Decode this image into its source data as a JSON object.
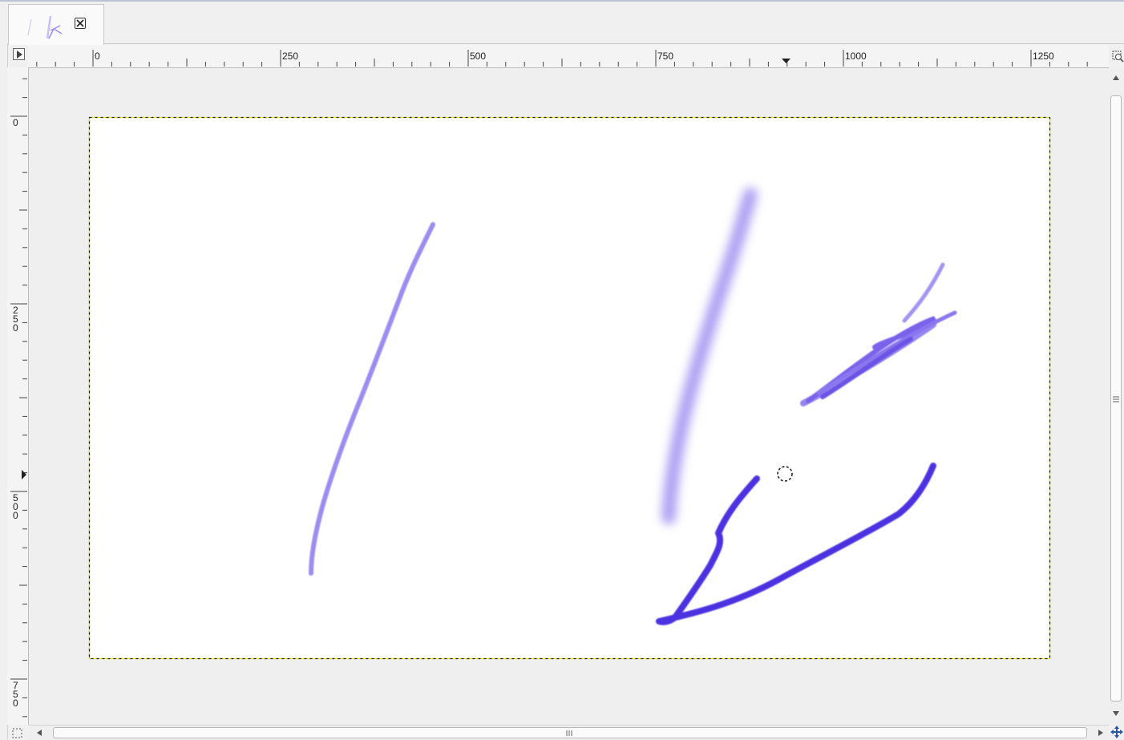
{
  "window": {
    "tab": {
      "thumbnail_icon": "image-thumbnail",
      "close_icon": "close-icon"
    }
  },
  "rulers": {
    "horizontal_labels": [
      "0",
      "250",
      "500",
      "750",
      "1000",
      "1250"
    ],
    "vertical_labels": [
      "0",
      "250",
      "500",
      "750"
    ]
  },
  "canvas": {
    "background": "#ffffff",
    "boundary_color": "#e6e600",
    "stroke_colors": [
      "#9b8aee",
      "#a395f0",
      "#6f55e6",
      "#4a2fe0"
    ],
    "brush_cursor_icon": "brush-outline-cursor"
  },
  "scrollbars": {
    "vertical_grip_icon": "grip-icon",
    "horizontal_grip_icon": "grip-icon"
  },
  "corner_icons": {
    "top_left": "menu-arrow-icon",
    "top_right": "zoom-icon",
    "bottom_left": "quick-mask-icon",
    "bottom_right": "navigate-icon"
  }
}
